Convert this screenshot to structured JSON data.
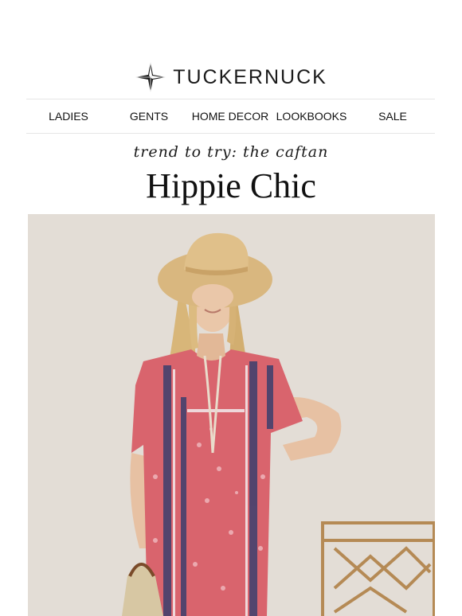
{
  "brand": {
    "name": "TUCKERNUCK",
    "logo_icon": "compass-star-icon"
  },
  "nav": {
    "items": [
      {
        "label": "LADIES"
      },
      {
        "label": "GENTS"
      },
      {
        "label": "HOME DECOR"
      },
      {
        "label": "LOOKBOOKS"
      },
      {
        "label": "SALE"
      }
    ]
  },
  "hero": {
    "kicker": "trend to try: the caftan",
    "headline": "Hippie Chic",
    "image_subject": "model-in-pink-caftan-and-straw-hat"
  },
  "colors": {
    "text": "#111111",
    "divider": "#e6e6e6",
    "photo_background": "#e7e1db",
    "caftan_pink": "#d9646d",
    "caftan_navy": "#3b3f6e",
    "hat_straw": "#d9b77f"
  }
}
